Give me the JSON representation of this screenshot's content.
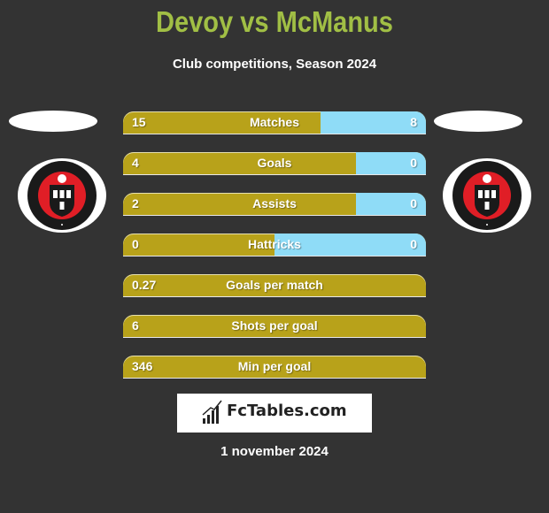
{
  "header": {
    "title": "Devoy vs McManus",
    "subtitle": "Club competitions, Season 2024"
  },
  "colors": {
    "background": "#333333",
    "title": "#a1bf45",
    "left_bar": "#b8a21a",
    "right_bar": "#8fdcf7"
  },
  "players": {
    "left": {
      "name": "Devoy",
      "club_crest": "bohemian-fc-crest-icon"
    },
    "right": {
      "name": "McManus",
      "club_crest": "bohemian-fc-crest-icon"
    }
  },
  "stats": [
    {
      "label": "Matches",
      "left": "15",
      "right": "8",
      "right_share": 0.348
    },
    {
      "label": "Goals",
      "left": "4",
      "right": "0",
      "right_share": 0.23
    },
    {
      "label": "Assists",
      "left": "2",
      "right": "0",
      "right_share": 0.23
    },
    {
      "label": "Hattricks",
      "left": "0",
      "right": "0",
      "right_share": 0.5
    },
    {
      "label": "Goals per match",
      "left": "0.27",
      "right": null,
      "right_share": 0
    },
    {
      "label": "Shots per goal",
      "left": "6",
      "right": null,
      "right_share": 0
    },
    {
      "label": "Min per goal",
      "left": "346",
      "right": null,
      "right_share": 0
    }
  ],
  "footer": {
    "brand": "FcTables.com",
    "brand_icon": "bar-chart-trend-icon",
    "date": "1 november 2024"
  }
}
